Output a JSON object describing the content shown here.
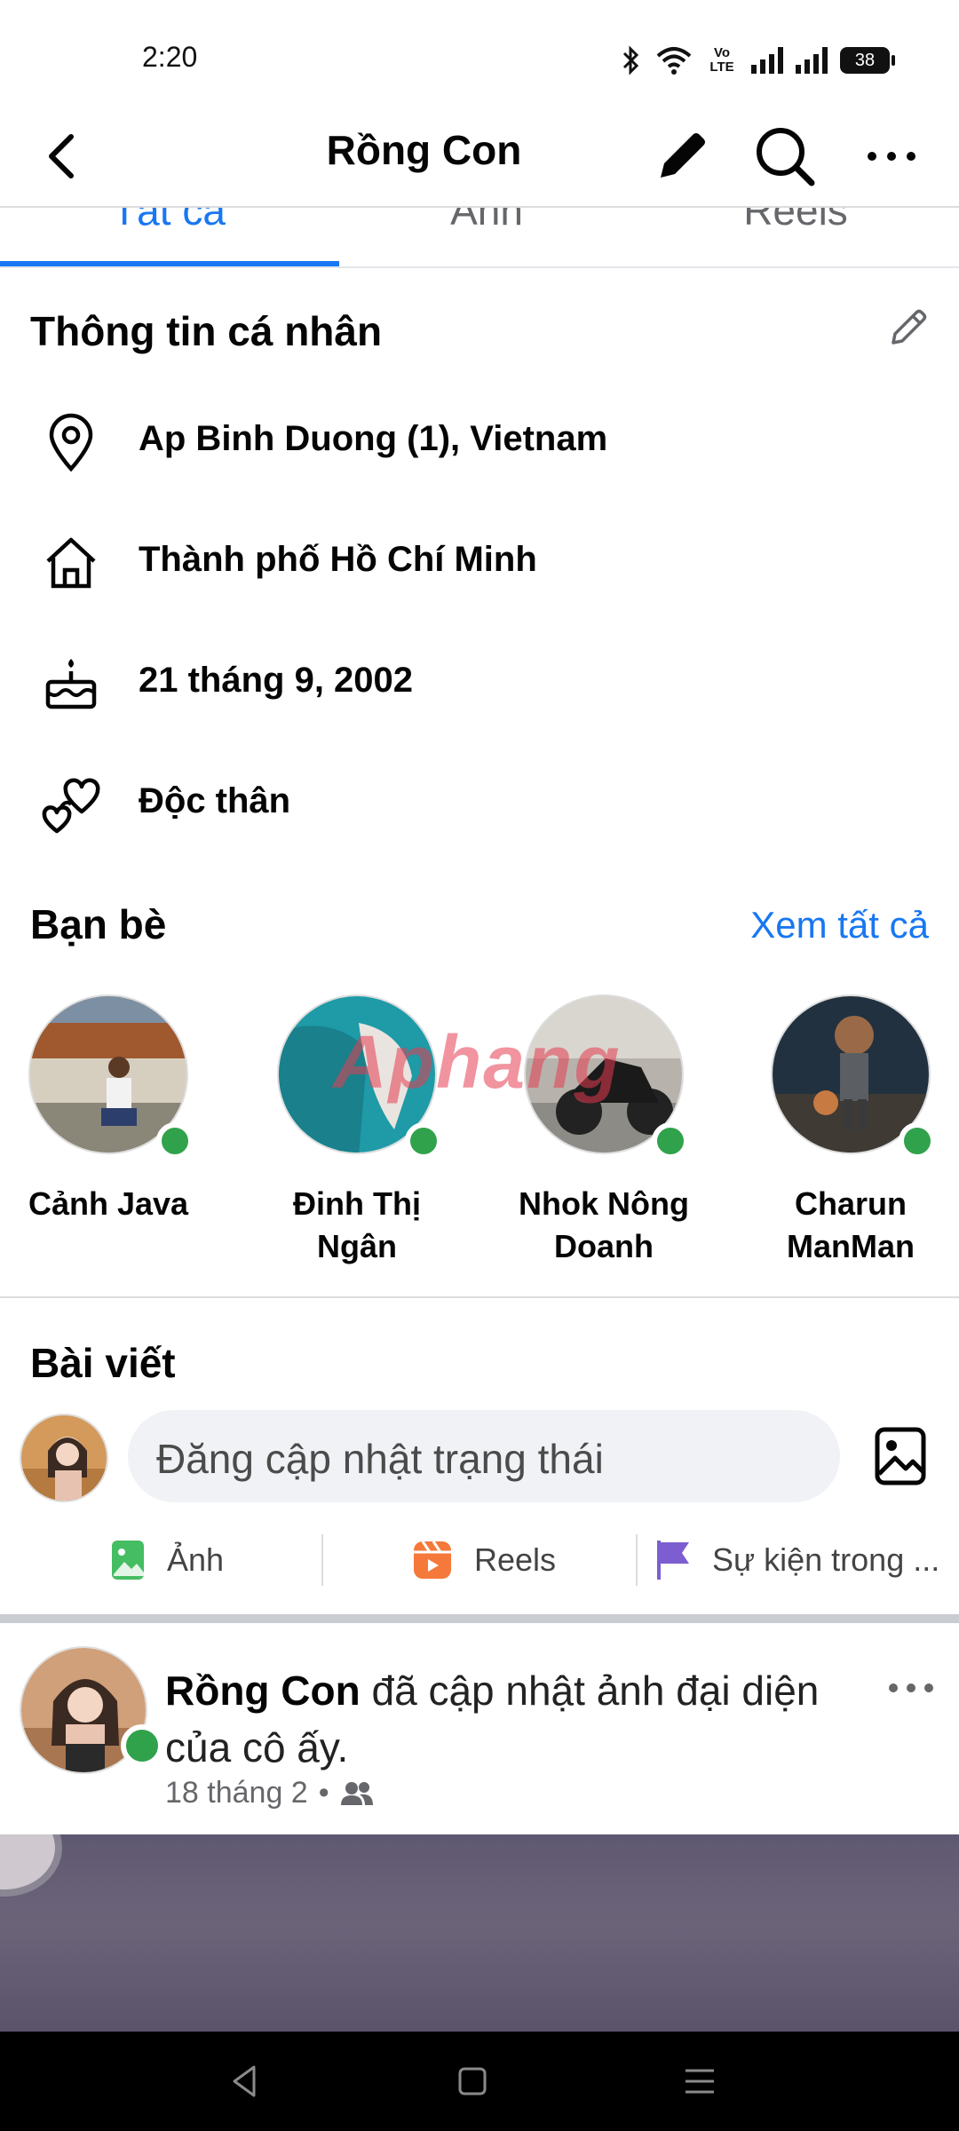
{
  "status_bar": {
    "time": "2:20",
    "network_label": "Vo LTE",
    "battery": "38"
  },
  "header": {
    "title": "Rồng Con"
  },
  "tabs": [
    {
      "label": "Tất cả",
      "active": true
    },
    {
      "label": "Ảnh",
      "active": false
    },
    {
      "label": "Reels",
      "active": false
    }
  ],
  "personal_info": {
    "title": "Thông tin cá nhân",
    "items": [
      {
        "icon": "location-pin-icon",
        "text": "Ap Binh Duong (1), Vietnam"
      },
      {
        "icon": "home-icon",
        "text": "Thành phố Hồ Chí Minh"
      },
      {
        "icon": "birthday-cake-icon",
        "text": "21 tháng 9, 2002"
      },
      {
        "icon": "hearts-icon",
        "text": "Độc thân"
      }
    ]
  },
  "friends": {
    "title": "Bạn bè",
    "see_all": "Xem tất cả",
    "list": [
      {
        "name": "Cảnh Java",
        "online": true
      },
      {
        "name": "Đinh Thị Ngân",
        "online": true
      },
      {
        "name": "Nhok Nông Doanh",
        "online": true
      },
      {
        "name": "Charun ManMan",
        "online": true
      }
    ]
  },
  "watermark": "Aphang",
  "posts": {
    "title": "Bài viết",
    "composer_placeholder": "Đăng cập nhật trạng thái",
    "actions": [
      {
        "label": "Ảnh",
        "icon": "photo-icon",
        "color": "#45bd62"
      },
      {
        "label": "Reels",
        "icon": "reels-icon",
        "color": "#f5793b"
      },
      {
        "label": "Sự kiện trong ...",
        "icon": "flag-icon",
        "color": "#7c5ed0"
      }
    ],
    "feed": [
      {
        "author": "Rồng Con",
        "action_text": "đã cập nhật ảnh đại diện của cô ấy.",
        "date": "18 tháng 2",
        "audience_icon": "friends-icon"
      }
    ]
  },
  "colors": {
    "accent": "#1877f2",
    "online": "#31a24c"
  }
}
